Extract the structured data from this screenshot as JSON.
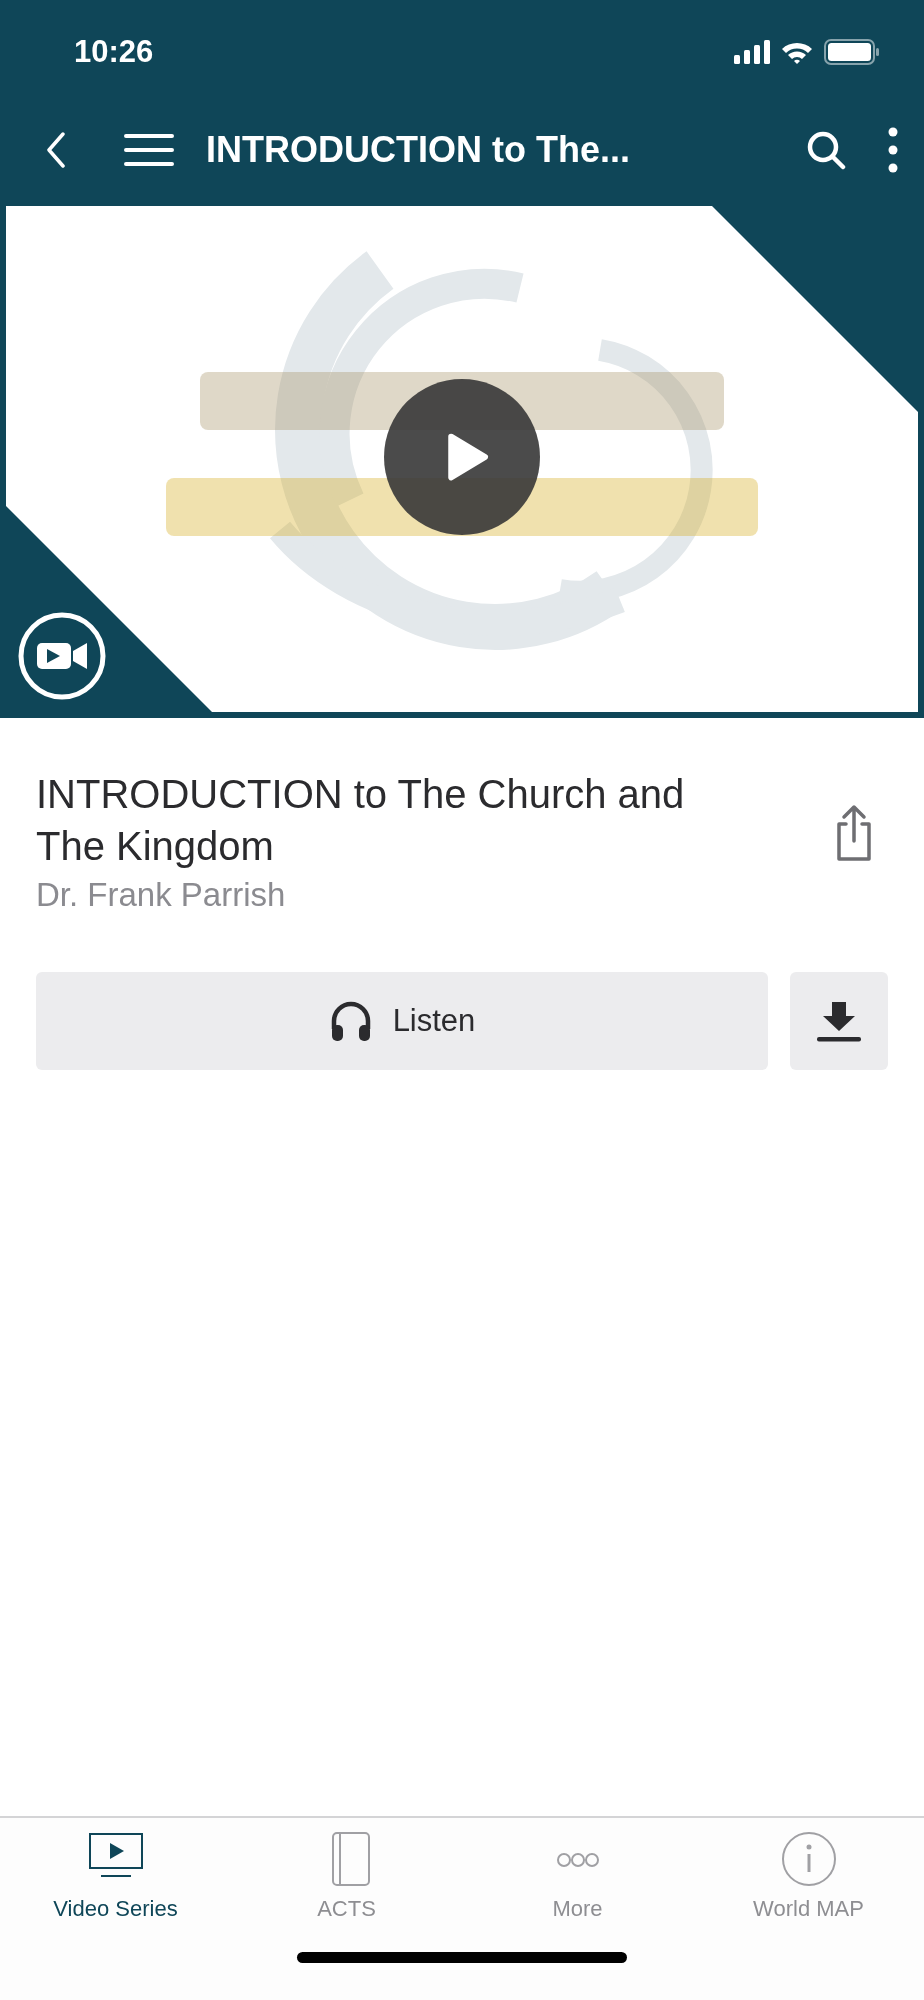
{
  "status_bar": {
    "time": "10:26"
  },
  "nav_bar": {
    "title": "INTRODUCTION to The..."
  },
  "lesson": {
    "title": "INTRODUCTION to The Church and The Kingdom",
    "author": "Dr. Frank Parrish"
  },
  "actions": {
    "listen": "Listen"
  },
  "tab_bar": [
    {
      "label": "Video Series",
      "selected": true
    },
    {
      "label": "ACTS",
      "selected": false
    },
    {
      "label": "More",
      "selected": false
    },
    {
      "label": "World MAP",
      "selected": false
    }
  ]
}
